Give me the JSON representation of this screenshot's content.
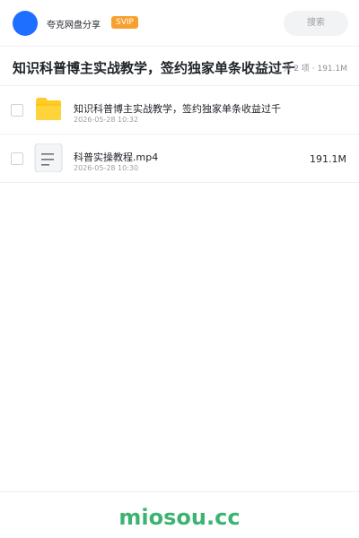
{
  "header": {
    "app_name": "夸克网盘分享",
    "badge": "SVIP",
    "search_placeholder": "搜索",
    "avatar_color": "#1e6fff",
    "badge_color": "#f7a02d"
  },
  "folder": {
    "title": "知识科普博主实战教学，签约独家单条收益过千",
    "summary": "共 2 项 · 191.1M"
  },
  "files": [
    {
      "name": "知识科普博主实战教学，签约独家单条收益过千",
      "time": "2026-05-28 10:32",
      "size": "",
      "icon": "folder-icon"
    },
    {
      "name": "科普实操教程.mp4",
      "time": "2026-05-28 10:30",
      "size": "191.1M",
      "icon": "document-icon"
    }
  ],
  "footer": {
    "logo_text": "miosou.cc",
    "logo_color": "#3cb371"
  }
}
